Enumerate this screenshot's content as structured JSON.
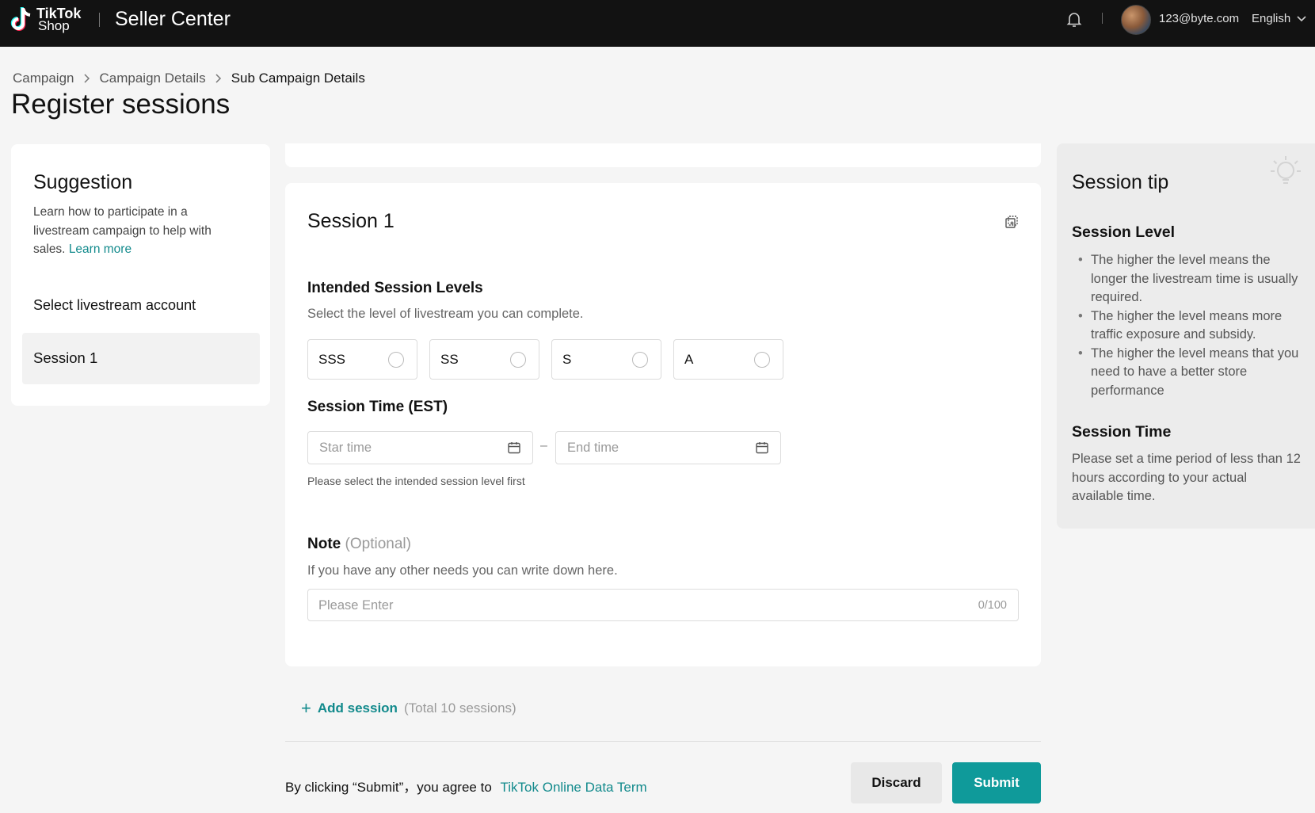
{
  "header": {
    "logo_line1": "TikTok",
    "logo_line2": "Shop",
    "app_title": "Seller Center",
    "user_email": "123@byte.com",
    "language": "English"
  },
  "breadcrumb": [
    "Campaign",
    "Campaign Details",
    "Sub Campaign Details"
  ],
  "page_title": "Register sessions",
  "suggestion": {
    "title": "Suggestion",
    "text": "Learn how to participate in a livestream campaign to help with sales.",
    "learn_more": "Learn more",
    "select_account": "Select livestream account",
    "session_item": "Session 1"
  },
  "session": {
    "title": "Session 1",
    "levels_title": "Intended Session Levels",
    "levels_desc": "Select the level of livestream you can complete.",
    "levels": [
      "SSS",
      "SS",
      "S",
      "A"
    ],
    "time_title": "Session Time (EST)",
    "start_placeholder": "Star time",
    "end_placeholder": "End time",
    "time_hint": "Please select the intended session level first",
    "note_title": "Note",
    "note_optional": "(Optional)",
    "note_desc": "If you have any other needs you can write down here.",
    "note_placeholder": "Please Enter",
    "note_count": "0/100"
  },
  "add_session": {
    "label": "Add session",
    "total": "(Total 10 sessions)"
  },
  "footer": {
    "agree_text": "By clicking “Submit”，you agree to",
    "term_link": "TikTok Online Data Term",
    "discard": "Discard",
    "submit": "Submit"
  },
  "tip": {
    "title": "Session tip",
    "level_title": "Session Level",
    "level_points": [
      "The higher the level means the longer the livestream time is usually required.",
      "The higher the level means more traffic exposure and subsidy.",
      "The higher the level means that you need to have a better store performance"
    ],
    "time_title": "Session Time",
    "time_text": "Please set a time period of less than 12 hours according to your actual available time."
  },
  "colors": {
    "accent": "#0f9a9a",
    "link": "#128a8c",
    "topbar": "#121212"
  },
  "icons": [
    "tiktok-logo",
    "bell-icon",
    "chevron-down-icon",
    "chevron-right-icon",
    "copy-icon",
    "calendar-icon",
    "plus-icon",
    "lightbulb-icon"
  ]
}
